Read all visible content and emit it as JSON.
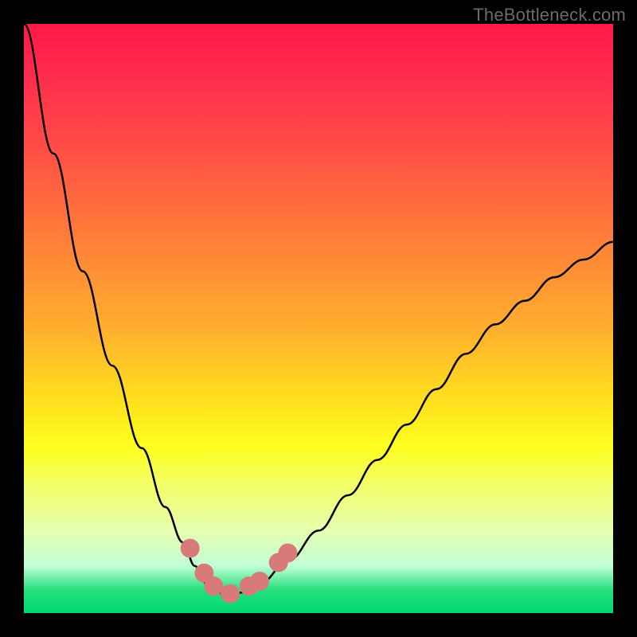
{
  "watermark": "TheBottleneck.com",
  "chart_data": {
    "type": "line",
    "title": "",
    "xlabel": "",
    "ylabel": "",
    "xlim": [
      0,
      100
    ],
    "ylim": [
      0,
      100
    ],
    "series": [
      {
        "name": "bottleneck-curve",
        "x": [
          0,
          5,
          10,
          15,
          20,
          24,
          27,
          29,
          31,
          33,
          35,
          37,
          40,
          45,
          50,
          55,
          60,
          65,
          70,
          75,
          80,
          85,
          90,
          95,
          100
        ],
        "values": [
          100,
          78,
          58,
          42,
          28,
          18,
          12,
          8,
          5,
          3.5,
          3,
          3.5,
          5,
          9,
          14,
          20,
          26,
          32,
          38,
          44,
          49,
          53,
          57,
          60,
          63
        ]
      }
    ],
    "markers": {
      "name": "highlight-points",
      "color": "#d97a7a",
      "points": [
        {
          "x": 28.2,
          "y": 11.0
        },
        {
          "x": 30.6,
          "y": 6.8
        },
        {
          "x": 32.2,
          "y": 4.6
        },
        {
          "x": 35.0,
          "y": 3.3
        },
        {
          "x": 38.2,
          "y": 4.6
        },
        {
          "x": 40.0,
          "y": 5.4
        },
        {
          "x": 43.2,
          "y": 8.6
        },
        {
          "x": 44.8,
          "y": 10.2
        }
      ]
    }
  }
}
